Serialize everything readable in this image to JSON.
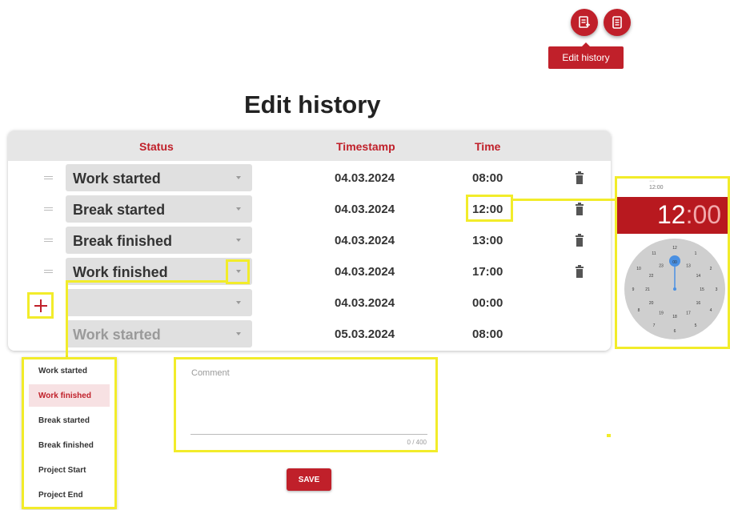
{
  "tooltip": "Edit history",
  "page_title": "Edit history",
  "icons": {
    "edit_history": "edit-history-icon",
    "notes": "notes-icon",
    "trash": "trash-icon",
    "add": "plus-icon",
    "drag": "drag-handle-icon"
  },
  "colors": {
    "accent": "#c0202a",
    "highlight": "#f2ec2a",
    "header_bg": "#e6e6e6",
    "select_bg": "#e0e0e0"
  },
  "table": {
    "headers": {
      "status": "Status",
      "timestamp": "Timestamp",
      "time": "Time"
    },
    "rows": [
      {
        "status": "Work started",
        "timestamp": "04.03.2024",
        "time": "08:00"
      },
      {
        "status": "Break started",
        "timestamp": "04.03.2024",
        "time": "12:00"
      },
      {
        "status": "Break finished",
        "timestamp": "04.03.2024",
        "time": "13:00"
      },
      {
        "status": "Work finished",
        "timestamp": "04.03.2024",
        "time": "17:00"
      },
      {
        "status": "",
        "timestamp": "04.03.2024",
        "time": "00:00"
      },
      {
        "status": "Work started",
        "timestamp": "05.03.2024",
        "time": "08:00"
      }
    ]
  },
  "status_menu": {
    "options": [
      "Work started",
      "Work finished",
      "Break started",
      "Break finished",
      "Project Start",
      "Project End"
    ],
    "selected": "Work finished"
  },
  "comment": {
    "label": "Comment",
    "counter": "0 / 400"
  },
  "save_label": "SAVE",
  "time_picker": {
    "top_label": "12:00",
    "hour": "12",
    "separator": ":",
    "minute": "00",
    "outer_hours": [
      "12",
      "1",
      "2",
      "3",
      "4",
      "5",
      "6",
      "7",
      "8",
      "9",
      "10",
      "11"
    ],
    "inner_hours": [
      "00",
      "13",
      "14",
      "15",
      "16",
      "17",
      "18",
      "19",
      "20",
      "21",
      "22",
      "23"
    ]
  }
}
